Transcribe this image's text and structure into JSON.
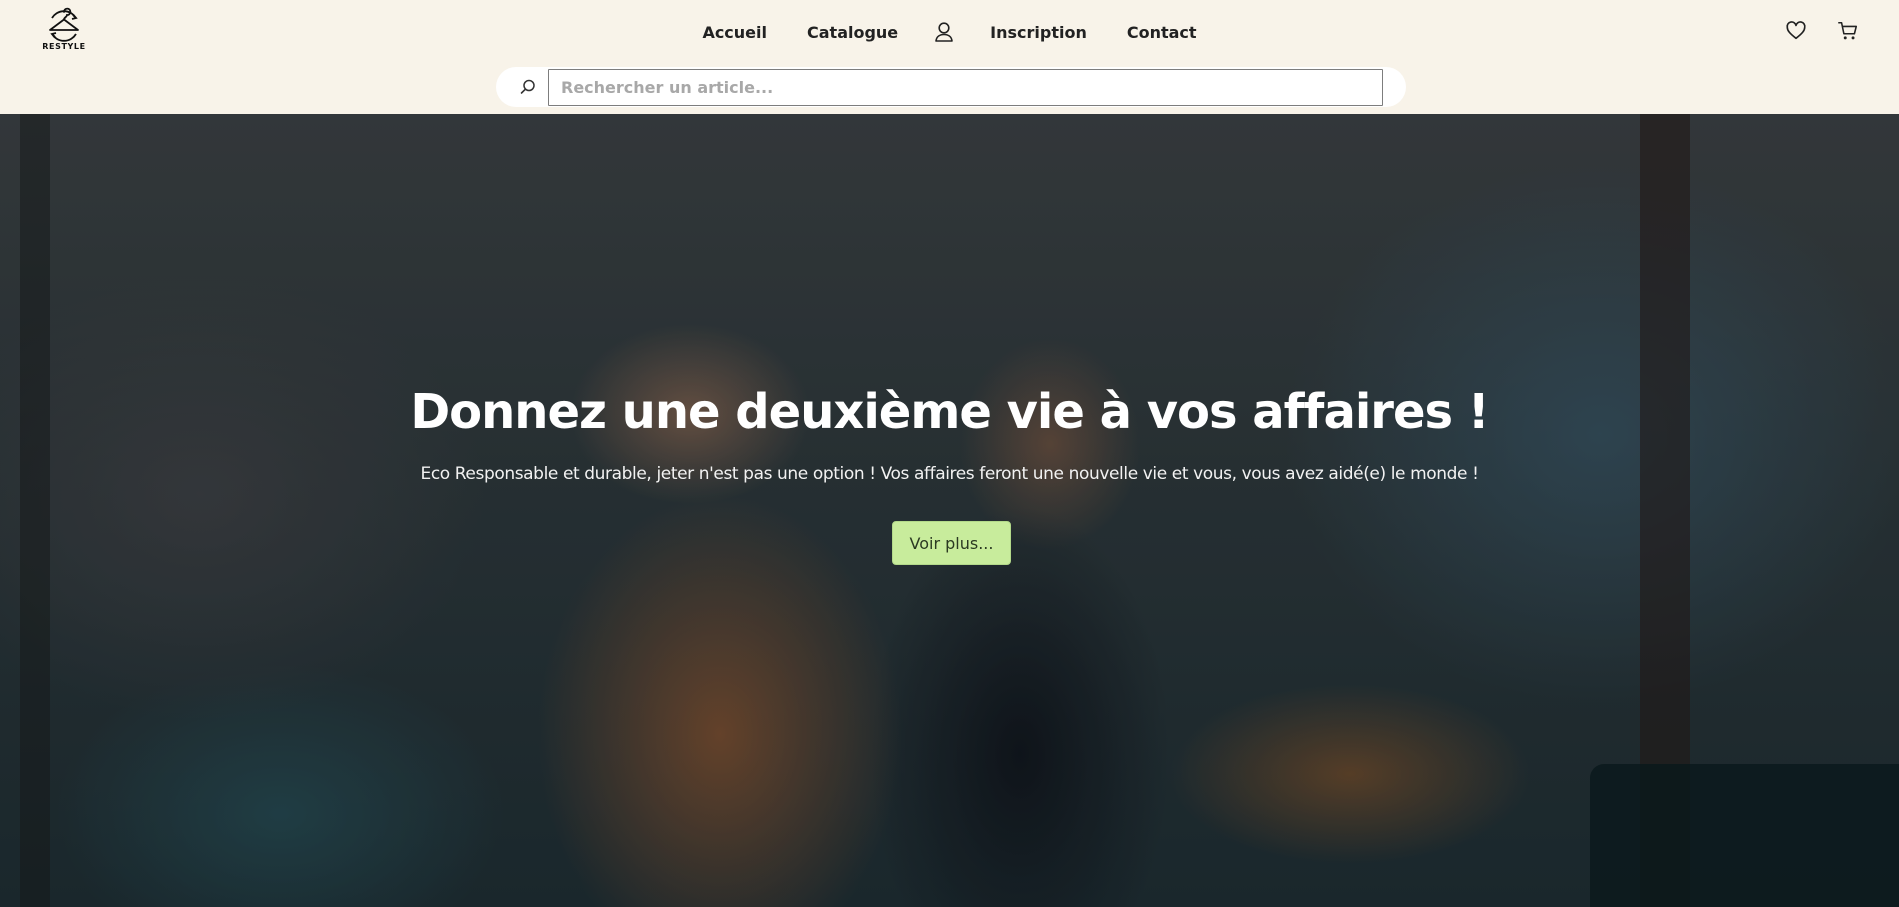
{
  "brand": {
    "name": "RESTYLE"
  },
  "nav": {
    "items": [
      "Accueil",
      "Catalogue",
      "Inscription",
      "Contact"
    ],
    "active": "Accueil"
  },
  "header_icons": [
    "heart-icon",
    "cart-icon",
    "user-icon"
  ],
  "search": {
    "placeholder": "Rechercher un article...",
    "value": ""
  },
  "hero": {
    "title": "Donnez une deuxième vie à vos affaires !",
    "subtitle": "Eco Responsable et durable, jeter n'est pas une option ! Vos affaires feront une nouvelle vie et vous, vous avez aidé(e) le monde !",
    "button_label": "Voir plus..."
  },
  "colors": {
    "header_bg": "#f8f3e9",
    "button_bg": "#c8ec9c",
    "text_dark": "#222222"
  }
}
